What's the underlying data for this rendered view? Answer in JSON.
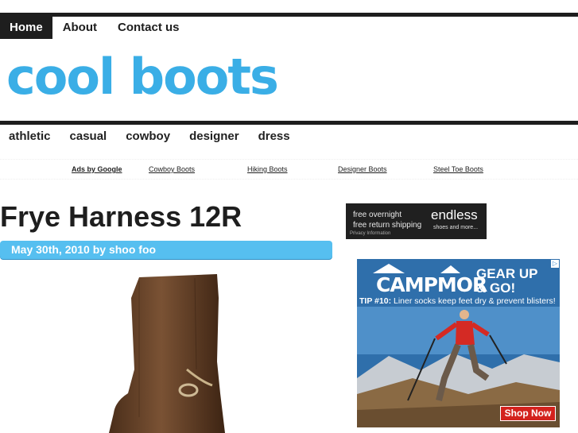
{
  "top_nav": {
    "items": [
      {
        "label": "Home"
      },
      {
        "label": "About"
      },
      {
        "label": "Contact us"
      }
    ]
  },
  "site": {
    "title": "cool boots"
  },
  "categories": {
    "items": [
      {
        "label": "athletic"
      },
      {
        "label": "casual"
      },
      {
        "label": "cowboy"
      },
      {
        "label": "designer"
      },
      {
        "label": "dress"
      }
    ]
  },
  "ad_links": {
    "label": "Ads by Google",
    "items": [
      {
        "label": "Cowboy Boots"
      },
      {
        "label": "Hiking Boots"
      },
      {
        "label": "Designer Boots"
      },
      {
        "label": "Steel Toe Boots"
      }
    ]
  },
  "post": {
    "title": "Frye Harness 12R",
    "meta": "May 30th, 2010 by shoo foo"
  },
  "ad_endless": {
    "line1": "free overnight",
    "line2": "free return shipping",
    "privacy": "Privacy Information",
    "brand": "endless",
    "sub": "shoes and more..."
  },
  "ad_campmor": {
    "brand": "CAMPMOR",
    "tagline1": "GEAR UP",
    "tagline2": "& GO!",
    "tip_label": "TIP #10:",
    "tip_text": "Liner socks keep feet dry & prevent blisters!",
    "cta": "Shop Now"
  },
  "colors": {
    "accent": "#3aaee6",
    "meta_bar": "#56bff0",
    "nav_dark": "#1e1e1e",
    "cta_red": "#d3221d"
  }
}
